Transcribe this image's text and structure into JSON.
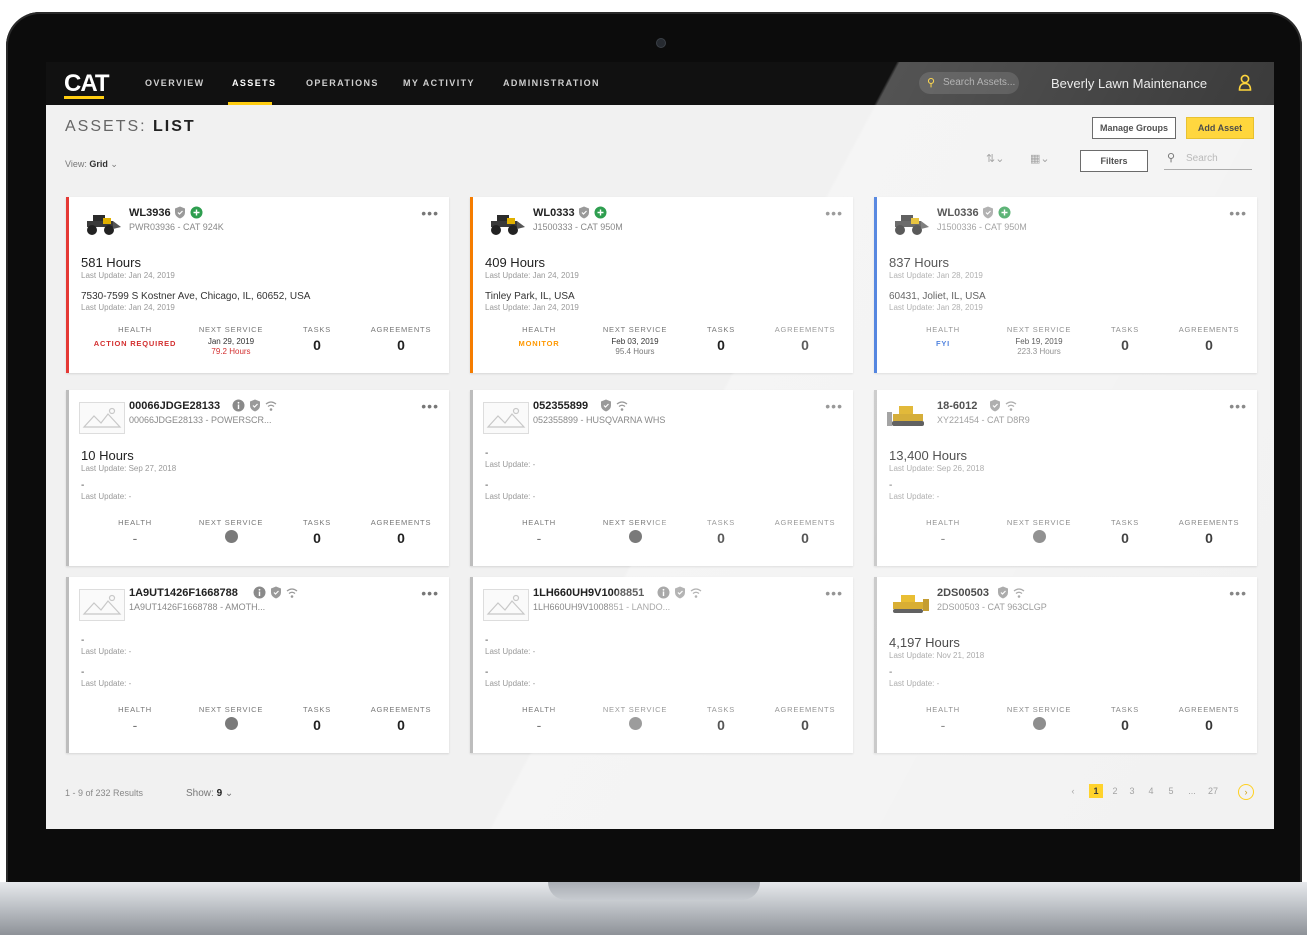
{
  "app": {
    "logo": "CAT",
    "accent": "#ffcd11"
  },
  "nav": {
    "items": [
      {
        "label": "OVERVIEW",
        "active": false
      },
      {
        "label": "ASSETS",
        "active": true
      },
      {
        "label": "OPERATIONS",
        "active": false
      },
      {
        "label": "MY ACTIVITY",
        "active": false
      },
      {
        "label": "ADMINISTRATION",
        "active": false
      }
    ],
    "search_placeholder": "Search Assets...",
    "account": "Beverly Lawn Maintenance"
  },
  "page": {
    "title_prefix": "ASSETS:",
    "title": "LIST",
    "view_label": "View:",
    "view_value": "Grid",
    "manage_groups": "Manage Groups",
    "add_asset": "Add Asset",
    "filters": "Filters",
    "search_placeholder": "Search"
  },
  "stat_labels": {
    "health": "HEALTH",
    "next_service": "NEXT SERVICE",
    "tasks": "TASKS",
    "agreements": "AGREEMENTS"
  },
  "cards": [
    {
      "id": "WL3936",
      "sub": "PWR03936 - CAT 924K",
      "hours": "581 Hours",
      "hours_updated": "Last Update: Jan 24, 2019",
      "address": "7530-7599 S Kostner Ave, Chicago, IL, 60652, USA",
      "address_updated": "Last Update: Jan 24, 2019",
      "health": "ACTION REQUIRED",
      "health_color": "#d32f2f",
      "next_service": "Jan 29, 2019",
      "next_service_sub": "79.2 Hours",
      "tasks": "0",
      "agreements": "0",
      "border": "#e53935"
    },
    {
      "id": "WL0333",
      "sub": "J1500333 - CAT 950M",
      "hours": "409 Hours",
      "hours_updated": "Last Update: Jan 24, 2019",
      "address": "Tinley Park, IL, USA",
      "address_updated": "Last Update: Jan 24, 2019",
      "health": "MONITOR",
      "health_color": "#ff9800",
      "next_service": "Feb 03, 2019",
      "next_service_sub": "95.4 Hours",
      "tasks": "0",
      "agreements": "0",
      "border": "#f57c00"
    },
    {
      "id": "WL0336",
      "sub": "J1500336 - CAT 950M",
      "hours": "837 Hours",
      "hours_updated": "Last Update: Jan 28, 2019",
      "address": "60431, Joliet, IL, USA",
      "address_updated": "Last Update: Jan 28, 2019",
      "health": "FYI",
      "health_color": "#1e5fd6",
      "next_service": "Feb 19, 2019",
      "next_service_sub": "223.3 Hours",
      "tasks": "0",
      "agreements": "0",
      "border": "#1e5fd6"
    },
    {
      "id": "00066JDGE28133",
      "sub": "00066JDGE28133 - POWERSCR...",
      "hours": "10 Hours",
      "hours_updated": "Last Update: Sep 27, 2018",
      "address": "-",
      "address_updated": "Last Update: -",
      "health": "-",
      "tasks": "0",
      "agreements": "0",
      "border": "#bdbdbd"
    },
    {
      "id": "052355899",
      "sub": "052355899 - HUSQVARNA WHS",
      "hours": "-",
      "hours_updated": "Last Update: -",
      "address": "-",
      "address_updated": "Last Update: -",
      "health": "-",
      "tasks": "0",
      "agreements": "0",
      "border": "#bdbdbd"
    },
    {
      "id": "18-6012",
      "sub": "XY221454 - CAT D8R9",
      "hours": "13,400 Hours",
      "hours_updated": "Last Update: Sep 26, 2018",
      "address": "-",
      "address_updated": "Last Update: -",
      "health": "-",
      "tasks": "0",
      "agreements": "0",
      "border": "#bdbdbd"
    },
    {
      "id": "1A9UT1426F1668788",
      "sub": "1A9UT1426F1668788 - AMOTH...",
      "hours": "-",
      "hours_updated": "Last Update: -",
      "address": "-",
      "address_updated": "Last Update: -",
      "health": "-",
      "tasks": "0",
      "agreements": "0",
      "border": "#bdbdbd"
    },
    {
      "id": "1LH660UH9V1008851",
      "sub": "1LH660UH9V1008851 - LANDO...",
      "hours": "-",
      "hours_updated": "Last Update: -",
      "address": "-",
      "address_updated": "Last Update: -",
      "health": "-",
      "tasks": "0",
      "agreements": "0",
      "border": "#bdbdbd"
    },
    {
      "id": "2DS00503",
      "sub": "2DS00503 - CAT 963CLGP",
      "hours": "4,197 Hours",
      "hours_updated": "Last Update: Nov 21, 2018",
      "address": "-",
      "address_updated": "Last Update: -",
      "health": "-",
      "tasks": "0",
      "agreements": "0",
      "border": "#bdbdbd"
    }
  ],
  "footer": {
    "results": "1 - 9 of 232 Results",
    "show_label": "Show:",
    "show_value": "9",
    "pages": [
      "1",
      "2",
      "3",
      "4",
      "5",
      "...",
      "27"
    ]
  }
}
